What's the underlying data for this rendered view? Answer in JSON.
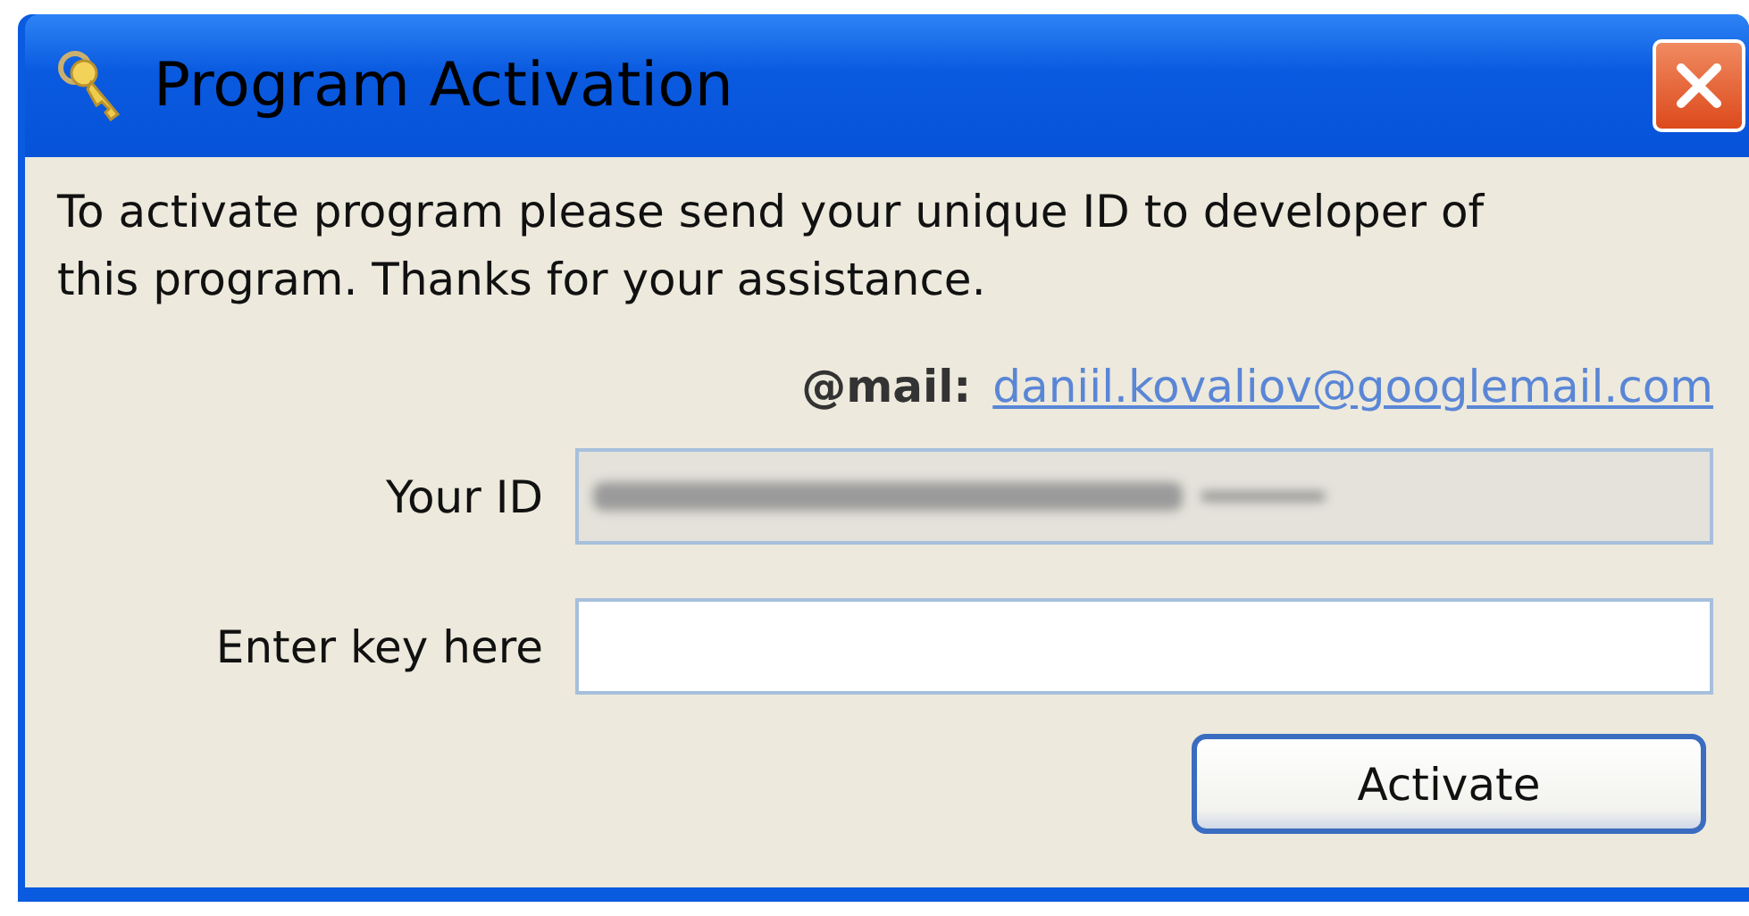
{
  "window": {
    "title": "Program Activation"
  },
  "message": "To activate program please send your unique ID to developer of this program. Thanks for your assistance.",
  "contact": {
    "label": "@mail:",
    "link": "daniil.kovaliov@googlemail.com"
  },
  "fields": [
    {
      "label": "Your ID",
      "kind": "blurred"
    },
    {
      "label": "Enter key here",
      "kind": "input"
    }
  ],
  "button": "Activate"
}
